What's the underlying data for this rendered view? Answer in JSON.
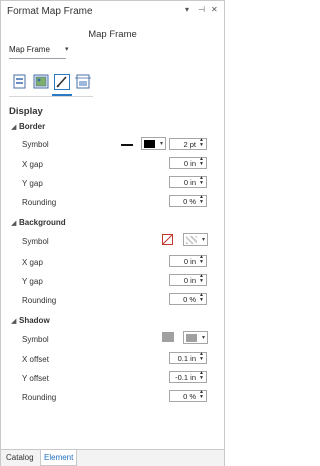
{
  "window": {
    "title": "Format Map Frame",
    "controls": [
      "▾",
      "⊣",
      "✕"
    ]
  },
  "heading": "Map Frame",
  "selector": {
    "value": "Map Frame"
  },
  "tab_icons": [
    {
      "name": "options-icon",
      "active": false
    },
    {
      "name": "map-frame-icon",
      "active": false
    },
    {
      "name": "symbol-pen-icon",
      "active": true
    },
    {
      "name": "placement-icon",
      "active": false
    }
  ],
  "section": "Display",
  "groups": {
    "border": {
      "title": "Border",
      "symbol_label": "Symbol",
      "symbol_width": "2 pt",
      "x_gap_label": "X gap",
      "x_gap": "0 in",
      "y_gap_label": "Y gap",
      "y_gap": "0 in",
      "rounding_label": "Rounding",
      "rounding": "0 %",
      "color": "#000000"
    },
    "background": {
      "title": "Background",
      "symbol_label": "Symbol",
      "x_gap_label": "X gap",
      "x_gap": "0 in",
      "y_gap_label": "Y gap",
      "y_gap": "0 in",
      "rounding_label": "Rounding",
      "rounding": "0 %"
    },
    "shadow": {
      "title": "Shadow",
      "symbol_label": "Symbol",
      "x_offset_label": "X offset",
      "x_offset": "0.1 in",
      "y_offset_label": "Y offset",
      "y_offset": "-0.1 in",
      "rounding_label": "Rounding",
      "rounding": "0 %",
      "color": "#a0a0a0"
    }
  },
  "bottom_tabs": [
    {
      "label": "Catalog",
      "active": false
    },
    {
      "label": "Element",
      "active": true
    }
  ],
  "colors": {
    "accent": "#2b79c2",
    "border": "#a6a6a6"
  }
}
